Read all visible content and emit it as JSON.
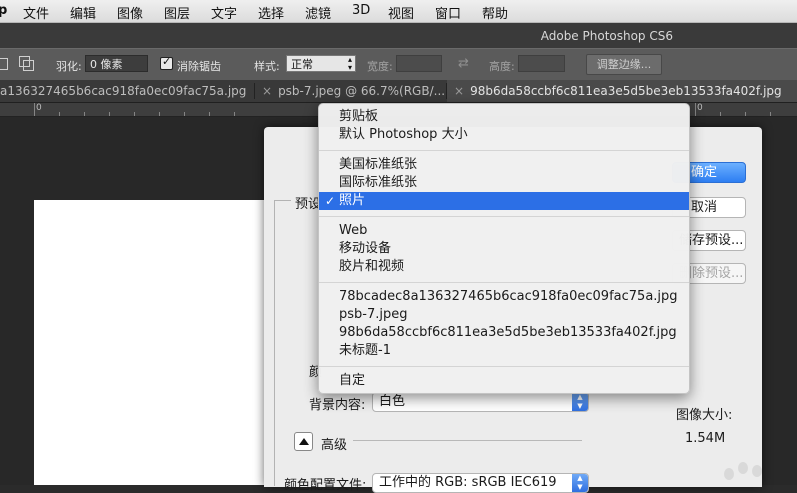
{
  "menubar": {
    "apple_fragment": "p",
    "items": [
      "文件",
      "编辑",
      "图像",
      "图层",
      "文字",
      "选择",
      "滤镜",
      "3D",
      "视图",
      "窗口",
      "帮助"
    ]
  },
  "titlebar": {
    "title": "Adobe Photoshop CS6"
  },
  "options": {
    "feather_label": "羽化:",
    "feather_value": "0 像素",
    "antialias_label": "消除锯齿",
    "antialias_checked": true,
    "style_label": "样式:",
    "style_value": "正常",
    "width_label": "宽度:",
    "height_label": "高度:",
    "refine_edge_label": "调整边缘..."
  },
  "tabs": [
    {
      "label": "a136327465b6cac918fa0ec09fac75a.jpg",
      "close": "",
      "active": false
    },
    {
      "label": "psb-7.jpeg @ 66.7%(RGB/...",
      "close": "×",
      "active": false
    },
    {
      "label": "98b6da58ccbf6c811ea3e5d5be3eb13533fa402f.jpg",
      "close": "×",
      "active": true
    }
  ],
  "ruler": {
    "labels": [
      "0",
      "0"
    ]
  },
  "dialog": {
    "preset_label": "预设",
    "color_mode_fragment": "颜",
    "background_label": "背景内容:",
    "background_value": "白色",
    "advanced_label": "高级",
    "color_profile_label": "颜色配置文件:",
    "color_profile_value": "工作中的 RGB: sRGB IEC619",
    "ok_label": "确定",
    "cancel_label": "取消",
    "save_preset_label": "储存预设...",
    "delete_preset_label": "删除预设...",
    "image_size_label": "图像大小:",
    "image_size_value": "1.54M"
  },
  "preset_menu": {
    "selected_index": 4,
    "items": [
      "剪贴板",
      "默认 Photoshop 大小",
      "美国标准纸张",
      "国际标准纸张",
      "照片",
      "Web",
      "移动设备",
      "胶片和视频",
      "78bcadec8a136327465b6cac918fa0ec09fac75a.jpg",
      "psb-7.jpeg",
      "98b6da58ccbf6c811ea3e5d5be3eb13533fa402f.jpg",
      "未标题-1",
      "自定"
    ]
  },
  "colors": {
    "menu_highlight": "#2c6fe6",
    "primary_button": "#2d7ef2",
    "workspace": "#282828"
  }
}
